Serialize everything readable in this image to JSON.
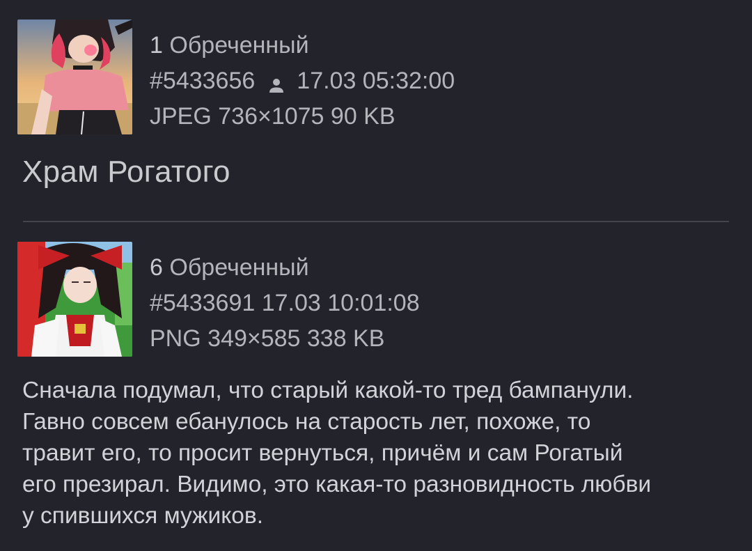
{
  "thread": {
    "subject": "Храм Рогатого"
  },
  "posts": [
    {
      "index": "1",
      "author": "Обреченный",
      "id": "#5433656",
      "date": "17.03 05:32:00",
      "file_info": "JPEG 736×1075 90 KB",
      "icon": "user-icon",
      "thumbnail": "anime-girl-pink-top-sunset"
    },
    {
      "index": "6",
      "author": "Обреченный",
      "id": "#5433691",
      "date": "17.03 10:01:08",
      "file_info": "PNG 349×585 338 KB",
      "thumbnail": "anime-shrine-maiden-red-bow",
      "comment": "Сначала подумал, что старый какой-то тред бампанули.\nГавно совсем ебанулось на старость лет, похоже, то\nтравит его, то просит вернуться, причём и сам Рогатый\nего презирал. Видимо, это какая-то разновидность любви\nу спившихся мужиков."
    }
  ],
  "colors": {
    "background": "#23242b",
    "divider": "#44454c",
    "meta_text": "#b4b5bb",
    "body_text": "#d2d3d8"
  }
}
